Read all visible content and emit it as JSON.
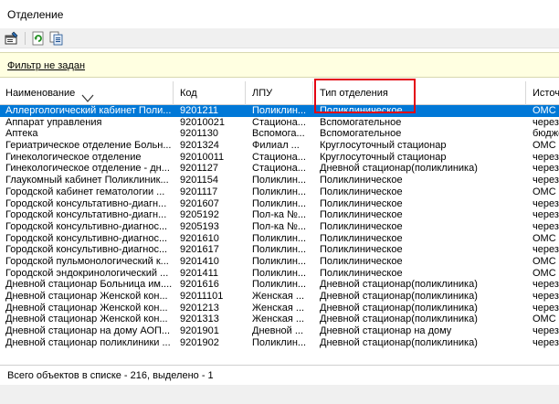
{
  "window": {
    "title": "Отделение"
  },
  "filter": {
    "text": "Фильтр не задан"
  },
  "columns": [
    "Наименование",
    "Код",
    "ЛПУ",
    "Тип отделения",
    "Источ"
  ],
  "rows": [
    [
      "Аллергологический кабинет Поли...",
      "9201211",
      "Поликлин...",
      "Поликлиническое",
      "ОМС"
    ],
    [
      "Аппарат управления",
      "92010021",
      "Стациона...",
      "Вспомогательное",
      "через"
    ],
    [
      "Аптека",
      "9201130",
      "Вспомога...",
      "Вспомогательное",
      "бюдже"
    ],
    [
      "Гериатрическое отделение Больн...",
      "9201324",
      "Филиал ...",
      "Круглосуточный стационар",
      "ОМС"
    ],
    [
      "Гинекологическое отделение",
      "92010011",
      "Стациона...",
      "Круглосуточный стационар",
      "через"
    ],
    [
      "Гинекологическое отделение - дн...",
      "9201127",
      "Стациона...",
      "Дневной стационар(поликлиника)",
      "через"
    ],
    [
      "Глаукомный кабинет Поликлиник...",
      "9201154",
      "Поликлин...",
      "Поликлиническое",
      "через"
    ],
    [
      "Городской кабинет гематологии ...",
      "9201117",
      "Поликлин...",
      "Поликлиническое",
      "ОМС"
    ],
    [
      "Городской консультативно-диагн...",
      "9201607",
      "Поликлин...",
      "Поликлиническое",
      "через"
    ],
    [
      "Городской консультативно-диагн...",
      "9205192",
      "Пол-ка №...",
      "Поликлиническое",
      "через"
    ],
    [
      "Городской консультивно-диагнос...",
      "9205193",
      "Пол-ка №...",
      "Поликлиническое",
      "через"
    ],
    [
      "Городской консультивно-диагнос...",
      "9201610",
      "Поликлин...",
      "Поликлиническое",
      "ОМС"
    ],
    [
      "Городской консультивно-диагнос...",
      "9201617",
      "Поликлин...",
      "Поликлиническое",
      "через"
    ],
    [
      "Городской пульмонологический к...",
      "9201410",
      "Поликлин...",
      "Поликлиническое",
      "ОМС"
    ],
    [
      "Городской эндокринологический ...",
      "9201411",
      "Поликлин...",
      "Поликлиническое",
      "ОМС"
    ],
    [
      "Дневной стационар Больница им....",
      "9201616",
      "Поликлин...",
      "Дневной стационар(поликлиника)",
      "через"
    ],
    [
      "Дневной стационар Женской кон...",
      "92011101",
      "Женская ...",
      "Дневной стационар(поликлиника)",
      "через"
    ],
    [
      "Дневной стационар Женской кон...",
      "9201213",
      "Женская ...",
      "Дневной стационар(поликлиника)",
      "через"
    ],
    [
      "Дневной стационар Женской кон...",
      "9201313",
      "Женская ...",
      "Дневной стационар(поликлиника)",
      "ОМС"
    ],
    [
      "Дневной стационар на дому АОП...",
      "9201901",
      "Дневной ...",
      "Дневной стационар на дому",
      "через"
    ],
    [
      "Дневной стационар поликлиники ...",
      "9201902",
      "Поликлин...",
      "Дневной стационар(поликлиника)",
      "через"
    ]
  ],
  "selected_row": 0,
  "status": {
    "text": "Всего объектов в списке - 216, выделено - 1"
  },
  "colors": {
    "selection": "#0078d7",
    "filter_bg": "#ffffe1",
    "highlight": "#e30613"
  },
  "icons": [
    "properties-icon",
    "refresh-icon",
    "export-icon",
    "sort-down-icon"
  ]
}
